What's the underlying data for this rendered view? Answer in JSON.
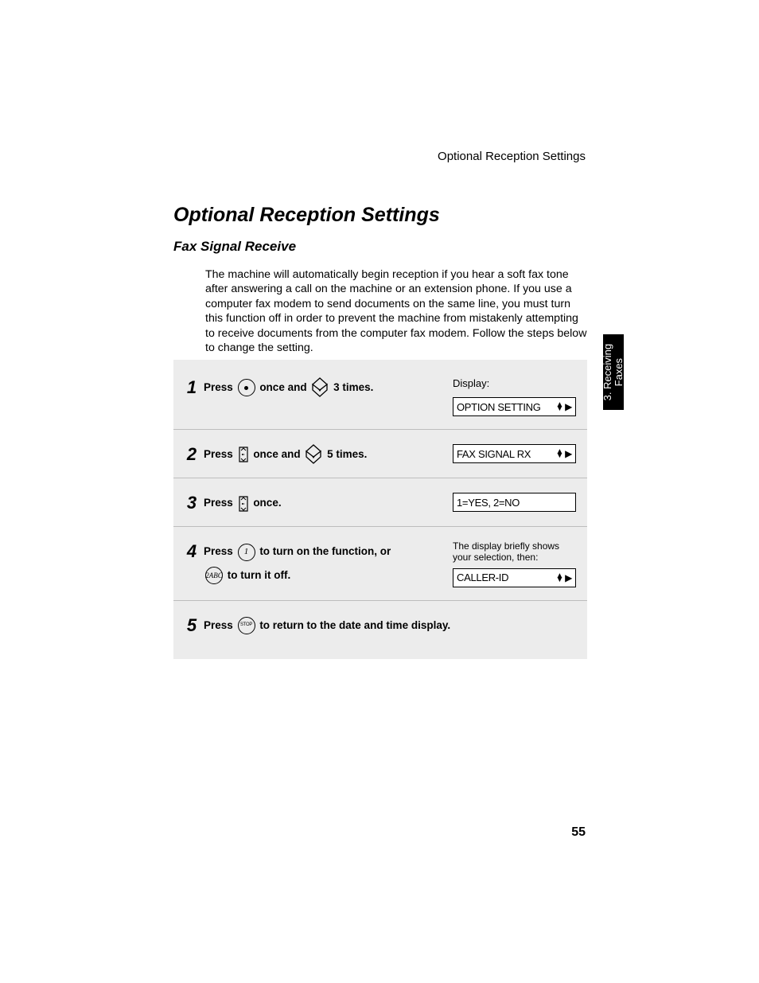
{
  "header": {
    "running": "Optional Reception Settings"
  },
  "title": "Optional Reception Settings",
  "subtitle": "Fax Signal Receive",
  "intro": "The machine will automatically begin reception if you hear a soft fax tone after answering a call on the machine or an extension phone. If you use a computer fax modem to send documents on the same line, you must turn this function off in order to prevent the machine from mistakenly attempting to receive documents from the computer fax modem. Follow the steps below to change the setting.",
  "steps": {
    "s1": {
      "num": "1",
      "pfx": "Press ",
      "mid": " once and ",
      "sfx": " 3 times.",
      "display_label": "Display:",
      "lcd": "OPTION SETTING"
    },
    "s2": {
      "num": "2",
      "pfx": "Press ",
      "mid": " once and ",
      "sfx": " 5 times.",
      "lcd": "FAX SIGNAL RX"
    },
    "s3": {
      "num": "3",
      "pfx": "Press ",
      "sfx": " once.",
      "lcd": "1=YES, 2=NO"
    },
    "s4": {
      "num": "4",
      "pfx": "Press ",
      "mid": " to turn on the function, or ",
      "sfx": " to turn it off.",
      "note": "The display briefly shows your selection, then:",
      "lcd": "CALLER-ID"
    },
    "s5": {
      "num": "5",
      "pfx": "Press ",
      "sfx": " to return to the date and time display."
    }
  },
  "icons": {
    "btn1_label": "1",
    "btn2_label": "2ABC",
    "stop_label": "STOP"
  },
  "side_tab": {
    "line1": "3. Receiving",
    "line2": "Faxes"
  },
  "page_number": "55"
}
